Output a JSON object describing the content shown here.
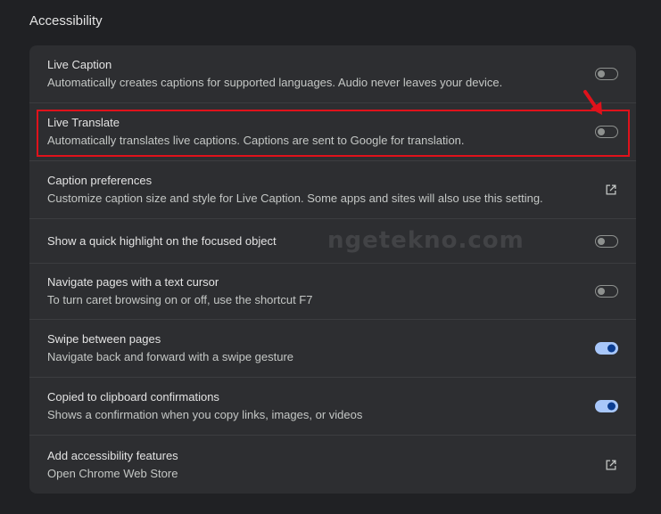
{
  "section": {
    "title": "Accessibility"
  },
  "rows": [
    {
      "title": "Live Caption",
      "description": "Automatically creates captions for supported languages. Audio never leaves your device.",
      "control": "toggle",
      "state": "off"
    },
    {
      "title": "Live Translate",
      "description": "Automatically translates live captions. Captions are sent to Google for translation.",
      "control": "toggle",
      "state": "off"
    },
    {
      "title": "Caption preferences",
      "description": "Customize caption size and style for Live Caption. Some apps and sites will also use this setting.",
      "control": "external-link"
    },
    {
      "title": "Show a quick highlight on the focused object",
      "description": "",
      "control": "toggle",
      "state": "off"
    },
    {
      "title": "Navigate pages with a text cursor",
      "description": "To turn caret browsing on or off, use the shortcut F7",
      "control": "toggle",
      "state": "off"
    },
    {
      "title": "Swipe between pages",
      "description": "Navigate back and forward with a swipe gesture",
      "control": "toggle",
      "state": "on"
    },
    {
      "title": "Copied to clipboard confirmations",
      "description": "Shows a confirmation when you copy links, images, or videos",
      "control": "toggle",
      "state": "on"
    },
    {
      "title": "Add accessibility features",
      "description": "Open Chrome Web Store",
      "control": "external-link"
    }
  ],
  "watermark": {
    "text": "ngetekno.com"
  },
  "colors": {
    "background": "#202124",
    "card": "#2d2e31",
    "toggle_on": "#a8c7fa",
    "toggle_off": "#8e918f",
    "highlight": "#e0121b"
  },
  "icons": {
    "external_link": "open-in-new-icon",
    "annotation_arrow": "red-arrow-icon"
  }
}
